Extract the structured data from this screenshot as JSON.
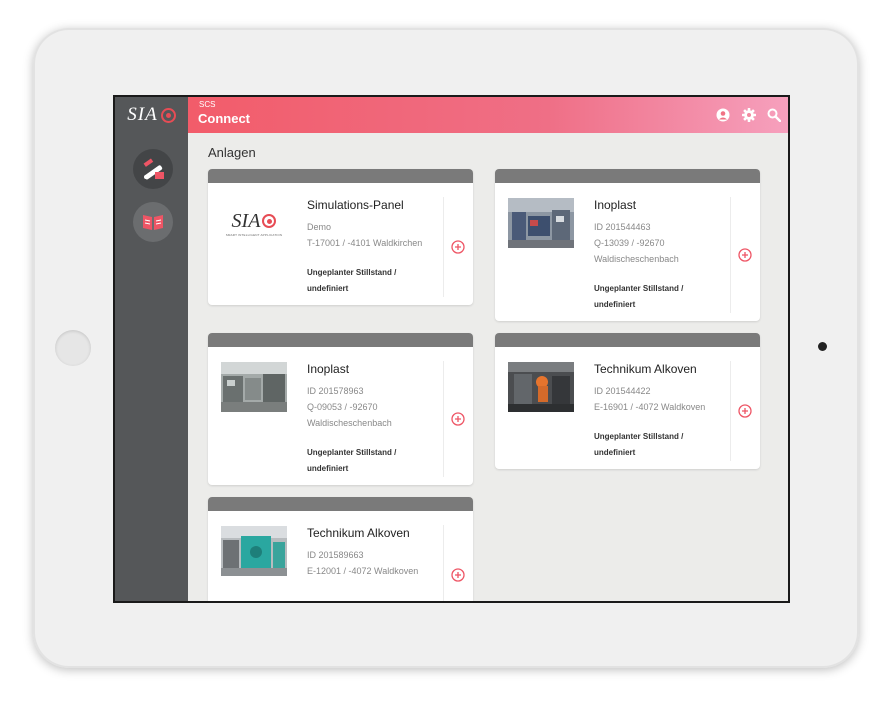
{
  "app": {
    "logo_text": "SIA",
    "subtitle": "SCS",
    "title": "Connect"
  },
  "header_icons": [
    "user-icon",
    "gear-icon",
    "search-icon"
  ],
  "sidebar": {
    "items": [
      {
        "name": "installation-icon",
        "active": true
      },
      {
        "name": "manual-icon",
        "active": false
      }
    ]
  },
  "section_title": "Anlagen",
  "colors": {
    "accent": "#ee5565",
    "header_start": "#f25c6a",
    "header_end": "#f6a0bd",
    "sidebar": "#555759"
  },
  "cards": [
    {
      "name": "Simulations-Panel",
      "lines": [
        "Demo",
        "T-17001 / -4101 Waldkirchen"
      ],
      "status": "Ungeplanter Stillstand / undefiniert",
      "logo_text": "SIA",
      "logo_tagline": "SMART INTELLIGENT APPLICATION"
    },
    {
      "name": "Inoplast",
      "lines": [
        "ID 201544463",
        "Q-13039 / -92670",
        "Waldischeschenbach"
      ],
      "status": "Ungeplanter Stillstand / undefiniert"
    },
    {
      "name": "Inoplast",
      "lines": [
        "ID 201578963",
        "Q-09053 / -92670",
        "Waldischeschenbach"
      ],
      "status": "Ungeplanter Stillstand / undefiniert"
    },
    {
      "name": "Technikum Alkoven",
      "lines": [
        "ID 201544422",
        "E-16901 / -4072 Waldkoven"
      ],
      "status": "Ungeplanter Stillstand / undefiniert"
    },
    {
      "name": "Technikum Alkoven",
      "lines": [
        "ID 201589663",
        "E-12001 / -4072 Waldkoven"
      ],
      "status": ""
    }
  ]
}
